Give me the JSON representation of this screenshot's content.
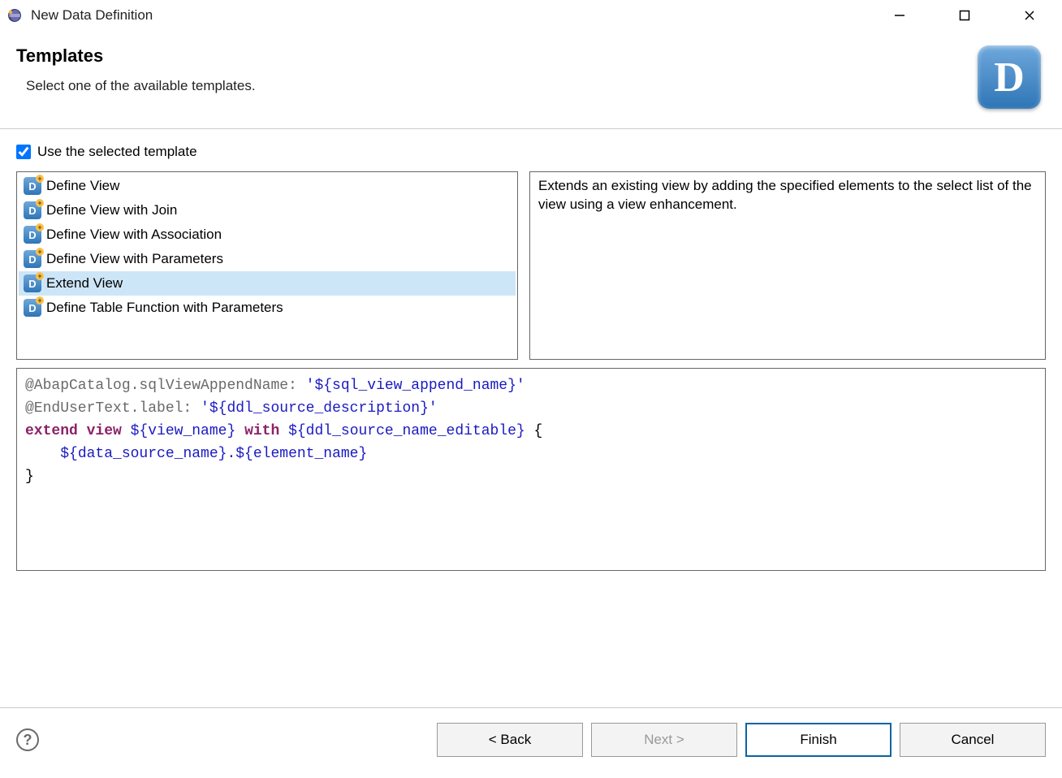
{
  "window": {
    "title": "New Data Definition"
  },
  "header": {
    "heading": "Templates",
    "subtitle": "Select one of the available templates."
  },
  "checkbox": {
    "label": "Use the selected template",
    "checked": true
  },
  "templates": {
    "items": [
      {
        "label": "Define View",
        "selected": false
      },
      {
        "label": "Define View with Join",
        "selected": false
      },
      {
        "label": "Define View with Association",
        "selected": false
      },
      {
        "label": "Define View with Parameters",
        "selected": false
      },
      {
        "label": "Extend View",
        "selected": true
      },
      {
        "label": "Define Table Function with Parameters",
        "selected": false
      }
    ],
    "description": "Extends an existing view by adding the specified elements to the select list of the view using a view enhancement."
  },
  "code": {
    "line1_anno": "@AbapCatalog.sqlViewAppendName: ",
    "line1_str": "'${sql_view_append_name}'",
    "line2_anno": "@EndUserText.label: ",
    "line2_str": "'${ddl_source_description}'",
    "line3_kw1": "extend view",
    "line3_tpl1": " ${view_name} ",
    "line3_kw2": "with",
    "line3_tpl2": " ${ddl_source_name_editable} ",
    "line3_brace": "{",
    "line4_indent": "    ",
    "line4_tpl": "${data_source_name}.${element_name}",
    "line5_brace": "}"
  },
  "footer": {
    "back": "< Back",
    "next": "Next >",
    "finish": "Finish",
    "cancel": "Cancel"
  }
}
